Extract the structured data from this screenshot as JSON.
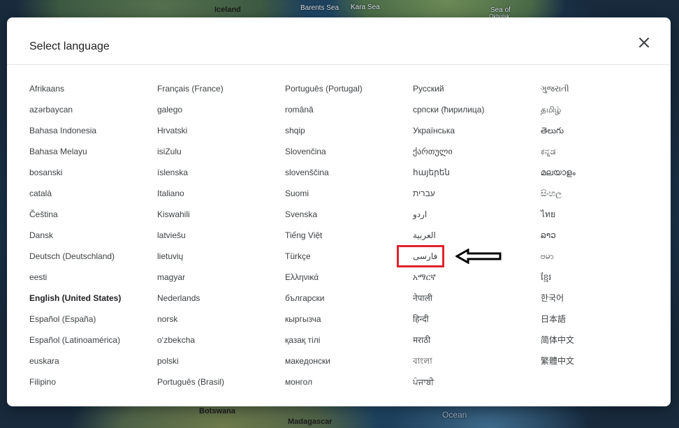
{
  "map": {
    "labels": [
      "Iceland",
      "Barents Sea",
      "Kara Sea",
      "Sea of",
      "Okhotsk",
      "Botswana",
      "Madagascar",
      "Ocean"
    ]
  },
  "dialog": {
    "title": "Select language",
    "close_icon": "close-icon",
    "columns": [
      [
        "Afrikaans",
        "azərbaycan",
        "Bahasa Indonesia",
        "Bahasa Melayu",
        "bosanski",
        "català",
        "Čeština",
        "Dansk",
        "Deutsch (Deutschland)",
        "eesti",
        "English (United States)",
        "Español (España)",
        "Español (Latinoamérica)",
        "euskara",
        "Filipino"
      ],
      [
        "Français (France)",
        "galego",
        "Hrvatski",
        "isiZulu",
        "íslenska",
        "Italiano",
        "Kiswahili",
        "latviešu",
        "lietuvių",
        "magyar",
        "Nederlands",
        "norsk",
        "o‘zbekcha",
        "polski",
        "Português (Brasil)"
      ],
      [
        "Português (Portugal)",
        "română",
        "shqip",
        "Slovenčina",
        "slovenščina",
        "Suomi",
        "Svenska",
        "Tiếng Việt",
        "Türkçe",
        "Ελληνικά",
        "български",
        "кыргызча",
        "қазақ тілі",
        "македонски",
        "монгол"
      ],
      [
        "Русский",
        "српски (ћирилица)",
        "Українська",
        "ქართული",
        "հայերեն",
        "עברית",
        "اردو",
        "العربية",
        "فارسی",
        "አማርኛ",
        "नेपाली",
        "हिन्दी",
        "मराठी",
        "বাংলা",
        "ਪੰਜਾਬੀ"
      ],
      [
        "ગુજરાતી",
        "தமிழ்",
        "తెలుగు",
        "ಕನ್ನಡ",
        "മലയാളം",
        "සිංහල",
        "ไทย",
        "ລາວ",
        "ဗမာ",
        "ខ្មែរ",
        "한국어",
        "日本語",
        "简体中文",
        "繁體中文"
      ]
    ],
    "selected": "English (United States)",
    "annotation": {
      "highlighted": "فارسی",
      "highlight_color": "#e0232e",
      "arrow_icon": "left-arrow-icon"
    }
  }
}
